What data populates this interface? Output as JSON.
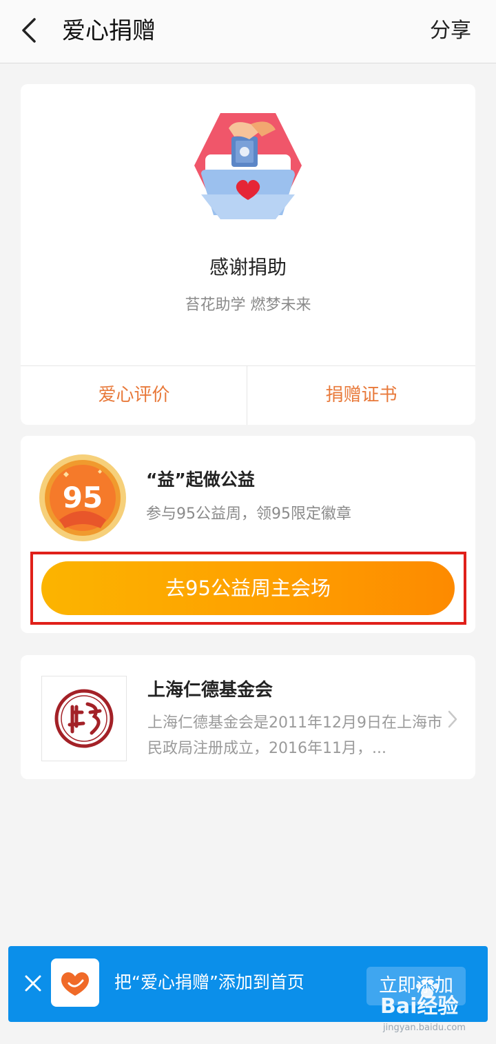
{
  "header": {
    "title": "爱心捐赠",
    "share_label": "分享"
  },
  "thanks_card": {
    "title": "感谢捐助",
    "subtitle": "苔花助学 燃梦未来",
    "actions": [
      {
        "label": "爱心评价"
      },
      {
        "label": "捐赠证书"
      }
    ]
  },
  "promo_card": {
    "badge_number": "95",
    "title": "“益”起做公益",
    "subtitle": "参与95公益周，领95限定徽章",
    "cta_label": "去95公益周主会场"
  },
  "org_card": {
    "name": "上海仁德基金会",
    "description": "上海仁德基金会是2011年12月9日在上海市民政局注册成立，2016年11月，..."
  },
  "add_banner": {
    "text": "把“爱心捐赠”添加到首页",
    "button_label": "立即添加"
  },
  "watermark": {
    "text": "Bai经验",
    "url": "jingyan.baidu.com"
  },
  "colors": {
    "accent_orange": "#e8793a",
    "cta_gradient_start": "#fcb400",
    "cta_gradient_end": "#fd8a00",
    "highlight_red": "#e0201a",
    "banner_blue": "#0b8fea"
  }
}
